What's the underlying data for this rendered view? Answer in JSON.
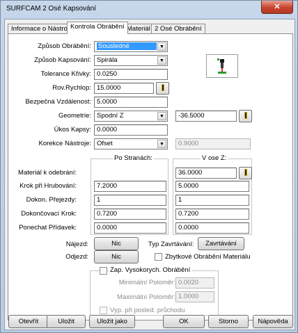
{
  "window": {
    "title": "SURFCAM 2 Osé Kapsování",
    "close_label": "✕"
  },
  "tabs": [
    {
      "label": "Informace o Nástroji",
      "active": false
    },
    {
      "label": "Kontrola Obrábění",
      "active": true
    },
    {
      "label": "Materiál",
      "active": false
    },
    {
      "label": "2 Osé Obrábění",
      "active": false
    }
  ],
  "fields": {
    "zpusob_obrabeni": {
      "label": "Způsob Obrábění:",
      "value": "Sousledné"
    },
    "zpusob_kapsovani": {
      "label": "Způsob Kapsování:",
      "value": "Spirála"
    },
    "tolerance_krivky": {
      "label": "Tolerance Křivky:",
      "value": "0.0250"
    },
    "rov_rychlop": {
      "label": "Rov.Rychlop:",
      "value": "15.0000"
    },
    "bezpecna_vzdalenost": {
      "label": "Bezpečná Vzdálenost:",
      "value": "5.0000"
    },
    "geometrie": {
      "label": "Geometrie:",
      "value": "Spodní Z",
      "value2": "-36.5000"
    },
    "ukos_kapsy": {
      "label": "Úkos Kapsy:",
      "value": "0.0000"
    },
    "korekce_nastroje": {
      "label": "Korekce Nástroje:",
      "value": "Ofset",
      "value2": "0.9000"
    }
  },
  "grid": {
    "col_headers": [
      "Po Stranách:",
      "V ose Z:"
    ],
    "rows": [
      {
        "label": "Materiál k odebrání:",
        "side": "",
        "z": "36.0000"
      },
      {
        "label": "Krok při Hrubování:",
        "side": "7.2000",
        "z": "5.0000"
      },
      {
        "label": "Dokon. Přejezdy:",
        "side": "1",
        "z": "1"
      },
      {
        "label": "Dokončovací Krok:",
        "side": "0.7200",
        "z": "0.7200"
      },
      {
        "label": "Ponechat Přídavek:",
        "side": "0.0000",
        "z": "0.0000"
      }
    ]
  },
  "najezd": {
    "label": "Nájezd:",
    "button": "Nic"
  },
  "odjezd": {
    "label": "Odjezd:",
    "button": "Nic"
  },
  "typ_zavrtavani": {
    "label": "Typ Zavrtávání:",
    "button": "Zavrtávání"
  },
  "zbytkove": {
    "label": "Zbytkové Obrábění Materiálu"
  },
  "hsm": {
    "label": "Zap. Vysokorych. Obrábění",
    "min_label": "Minimální Poloměr:",
    "min_value": "0.0020",
    "max_label": "Maximální Poloměr:",
    "max_value": "1.0000",
    "last_label": "Vyp. při posled. průchodu"
  },
  "footer": {
    "open": "Otevřít",
    "save": "Uložit",
    "save_as": "Uložit jako",
    "ok": "OK",
    "cancel": "Storno",
    "help": "Nápověda"
  }
}
